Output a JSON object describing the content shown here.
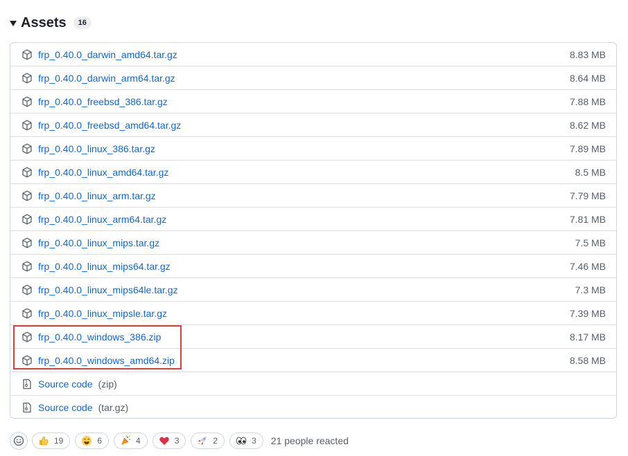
{
  "assets": {
    "title": "Assets",
    "count": "16",
    "items": [
      {
        "name": "frp_0.40.0_darwin_amd64.tar.gz",
        "size": "8.83 MB",
        "icon": "package-icon"
      },
      {
        "name": "frp_0.40.0_darwin_arm64.tar.gz",
        "size": "8.64 MB",
        "icon": "package-icon"
      },
      {
        "name": "frp_0.40.0_freebsd_386.tar.gz",
        "size": "7.88 MB",
        "icon": "package-icon"
      },
      {
        "name": "frp_0.40.0_freebsd_amd64.tar.gz",
        "size": "8.62 MB",
        "icon": "package-icon"
      },
      {
        "name": "frp_0.40.0_linux_386.tar.gz",
        "size": "7.89 MB",
        "icon": "package-icon"
      },
      {
        "name": "frp_0.40.0_linux_amd64.tar.gz",
        "size": "8.5 MB",
        "icon": "package-icon"
      },
      {
        "name": "frp_0.40.0_linux_arm.tar.gz",
        "size": "7.79 MB",
        "icon": "package-icon"
      },
      {
        "name": "frp_0.40.0_linux_arm64.tar.gz",
        "size": "7.81 MB",
        "icon": "package-icon"
      },
      {
        "name": "frp_0.40.0_linux_mips.tar.gz",
        "size": "7.5 MB",
        "icon": "package-icon"
      },
      {
        "name": "frp_0.40.0_linux_mips64.tar.gz",
        "size": "7.46 MB",
        "icon": "package-icon"
      },
      {
        "name": "frp_0.40.0_linux_mips64le.tar.gz",
        "size": "7.3 MB",
        "icon": "package-icon"
      },
      {
        "name": "frp_0.40.0_linux_mipsle.tar.gz",
        "size": "7.39 MB",
        "icon": "package-icon"
      },
      {
        "name": "frp_0.40.0_windows_386.zip",
        "size": "8.17 MB",
        "icon": "package-icon"
      },
      {
        "name": "frp_0.40.0_windows_amd64.zip",
        "size": "8.58 MB",
        "icon": "package-icon"
      }
    ],
    "source": [
      {
        "label": "Source code",
        "suffix": "(zip)",
        "icon": "file-zip-icon"
      },
      {
        "label": "Source code",
        "suffix": "(tar.gz)",
        "icon": "file-zip-icon"
      }
    ]
  },
  "reactions": {
    "items": [
      {
        "emoji": "thumbs-up-icon",
        "count": "19"
      },
      {
        "emoji": "laugh-icon",
        "count": "6"
      },
      {
        "emoji": "hooray-icon",
        "count": "4"
      },
      {
        "emoji": "heart-icon",
        "count": "3"
      },
      {
        "emoji": "rocket-icon",
        "count": "2"
      },
      {
        "emoji": "eyes-icon",
        "count": "3"
      }
    ],
    "summary": "21 people reacted"
  },
  "colors": {
    "link": "#0969da",
    "muted": "#57606a",
    "border": "#d0d7de",
    "highlight": "#e03e3e"
  }
}
